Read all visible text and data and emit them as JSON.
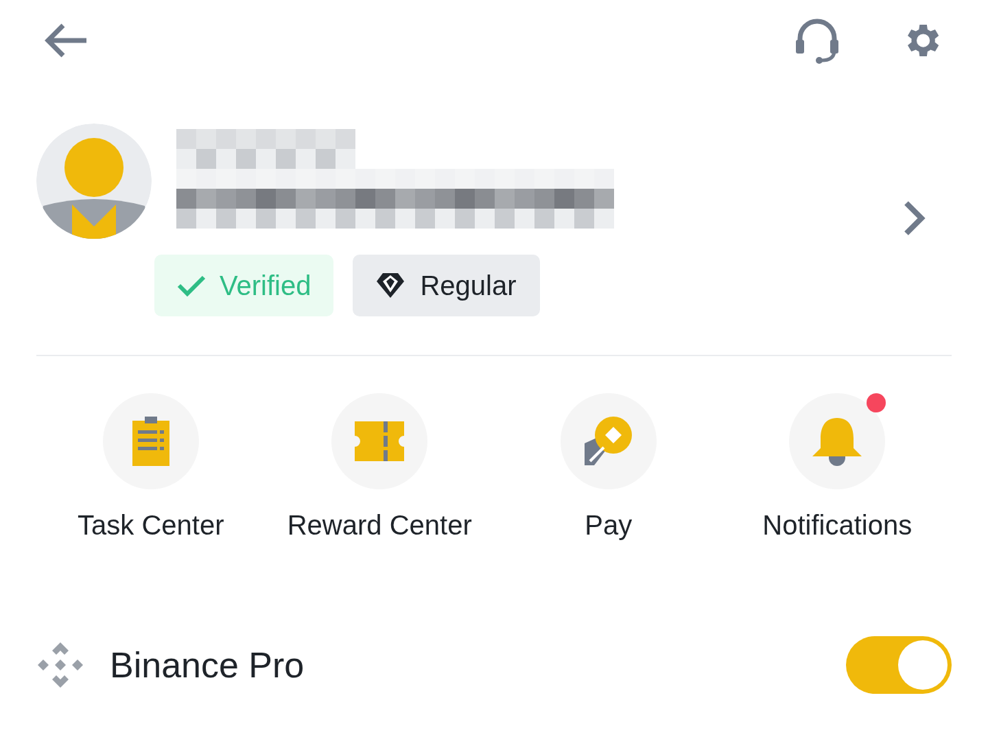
{
  "badges": [
    {
      "label": "Verified",
      "kind": "verified"
    },
    {
      "label": "Regular",
      "kind": "tier"
    }
  ],
  "shortcuts": [
    {
      "label": "Task Center",
      "kind": "task",
      "unread": false
    },
    {
      "label": "Reward Center",
      "kind": "reward",
      "unread": false
    },
    {
      "label": "Pay",
      "kind": "pay",
      "unread": false
    },
    {
      "label": "Notifications",
      "kind": "bell",
      "unread": true
    }
  ],
  "pro_mode": {
    "label": "Binance Pro",
    "on": true
  }
}
